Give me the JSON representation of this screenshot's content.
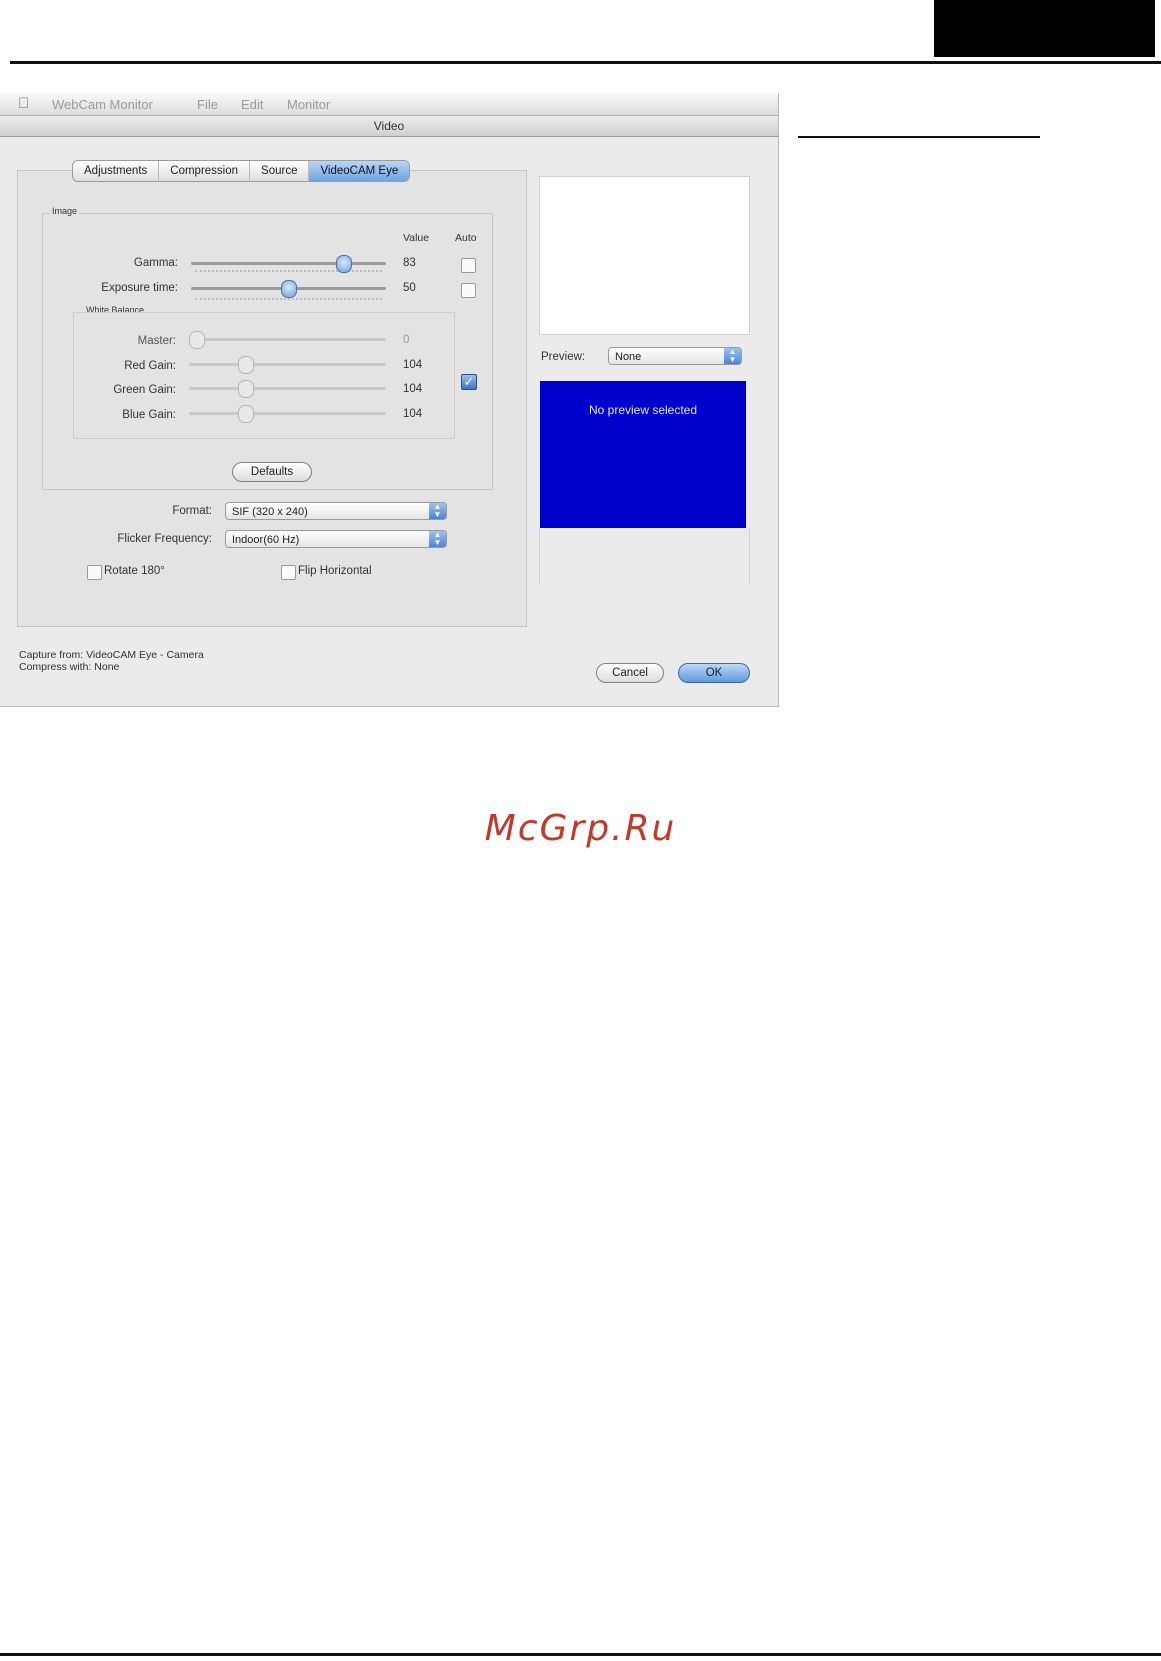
{
  "window": {
    "menubar": [
      "WebCam Monitor",
      "File",
      "Edit",
      "Monitor"
    ],
    "title": "Video"
  },
  "tabs": [
    {
      "label": "Adjustments",
      "selected": false
    },
    {
      "label": "Compression",
      "selected": false
    },
    {
      "label": "Source",
      "selected": false
    },
    {
      "label": "VideoCAM Eye",
      "selected": true
    }
  ],
  "image_group": {
    "label": "Image",
    "col_value": "Value",
    "col_auto": "Auto",
    "gamma": {
      "label": "Gamma:",
      "value": "83",
      "level": 0.81
    },
    "exposure": {
      "label": "Exposure time:",
      "value": "50",
      "level": 0.5
    }
  },
  "white_balance": {
    "label": "White Balance",
    "master": {
      "label": "Master:",
      "value": "0",
      "level": 0.0
    },
    "red": {
      "label": "Red Gain:",
      "value": "104",
      "level": 0.27
    },
    "green": {
      "label": "Green Gain:",
      "value": "104",
      "level": 0.27
    },
    "blue": {
      "label": "Blue Gain:",
      "value": "104",
      "level": 0.27
    },
    "auto_checked": true
  },
  "defaults_button": "Defaults",
  "format": {
    "label": "Format:",
    "value": "SIF (320 x 240)"
  },
  "flicker": {
    "label": "Flicker Frequency:",
    "value": "Indoor(60 Hz)"
  },
  "rotate": {
    "label": "Rotate 180°",
    "checked": false
  },
  "flip": {
    "label": "Flip Horizontal",
    "checked": false
  },
  "preview": {
    "label": "Preview:",
    "value": "None",
    "message": "No preview selected"
  },
  "status": {
    "line1": "Capture from: VideoCAM Eye - Camera",
    "line2": "Compress with: None"
  },
  "buttons": {
    "cancel": "Cancel",
    "ok": "OK"
  },
  "watermark": "McGrp.Ru",
  "colors": {
    "preview_bg": "#0000cc",
    "selected_tab": "#6fa4e2",
    "watermark": "#c0392b"
  }
}
